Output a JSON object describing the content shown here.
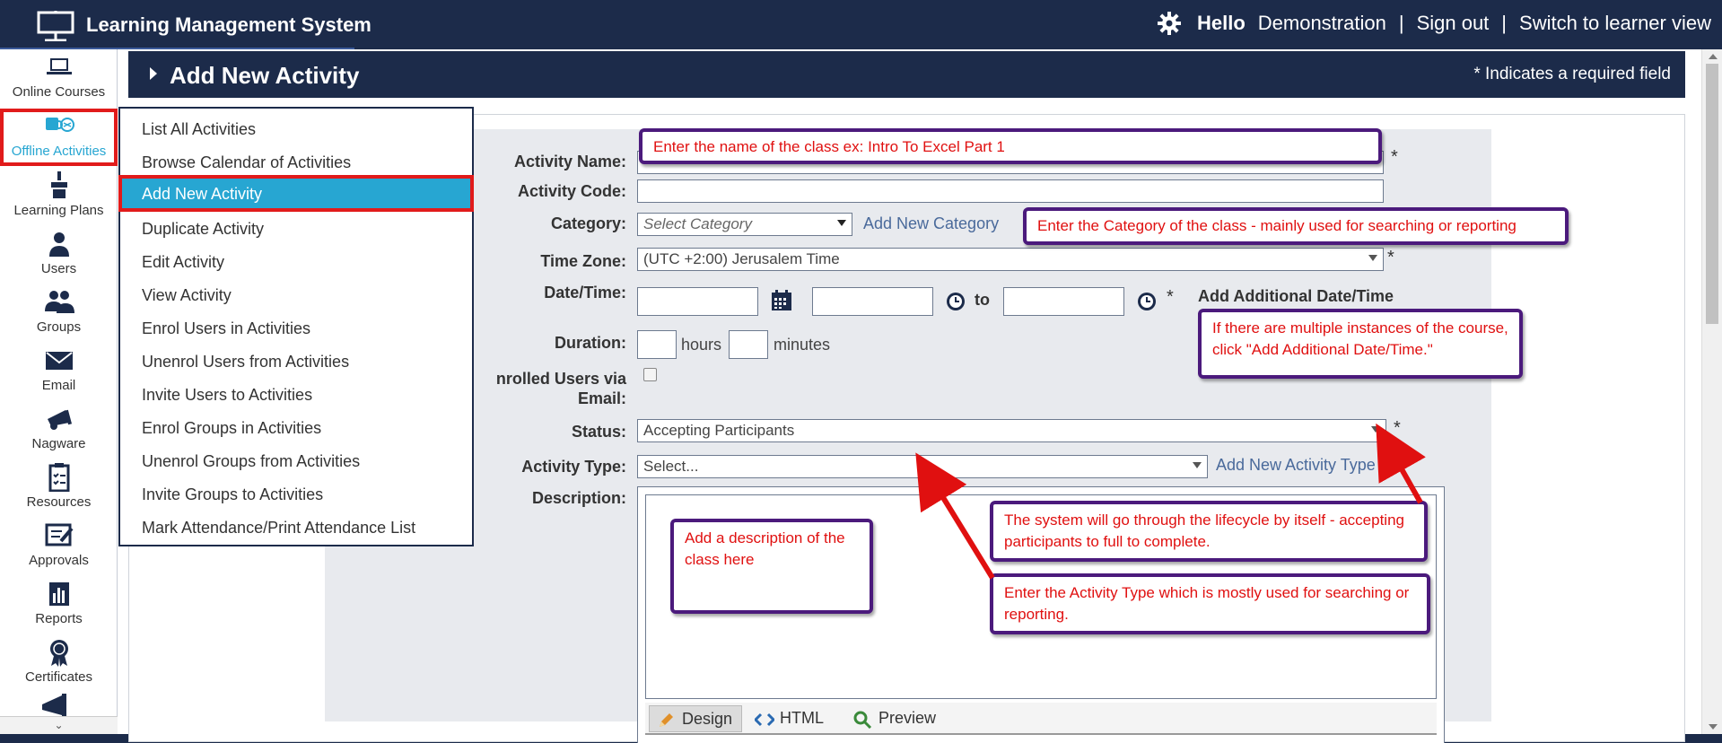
{
  "app": {
    "title": "Learning Management System"
  },
  "header": {
    "hello": "Hello",
    "user_name": "Demonstration",
    "separator": "|",
    "sign_out": "Sign out",
    "switch_view": "Switch to learner view"
  },
  "nav": {
    "items": [
      {
        "label": "Online Courses",
        "icon": "laptop-icon"
      },
      {
        "label": "Offline Activities",
        "icon": "offline-activities-icon",
        "active": true
      },
      {
        "label": "Learning Plans",
        "icon": "learning-plans-icon"
      },
      {
        "label": "Users",
        "icon": "user-icon"
      },
      {
        "label": "Groups",
        "icon": "groups-icon"
      },
      {
        "label": "Email",
        "icon": "envelope-icon"
      },
      {
        "label": "Nagware",
        "icon": "megaphone-icon"
      },
      {
        "label": "Resources",
        "icon": "clipboard-icon"
      },
      {
        "label": "Approvals",
        "icon": "approvals-icon"
      },
      {
        "label": "Reports",
        "icon": "bar-chart-icon"
      },
      {
        "label": "Certificates",
        "icon": "ribbon-icon"
      }
    ],
    "scroll_symbol": "⌄"
  },
  "page": {
    "title": "Add New Activity",
    "required_note": "* Indicates a required field"
  },
  "menu": {
    "items": [
      "List All Activities",
      "Browse Calendar of Activities",
      "Add New Activity",
      "Duplicate Activity",
      "Edit Activity",
      "View Activity",
      "Enrol Users in Activities",
      "Unenrol Users from Activities",
      "Invite Users to Activities",
      "Enrol Groups in Activities",
      "Unenrol Groups from Activities",
      "Invite Groups to Activities",
      "Mark Attendance/Print Attendance List"
    ],
    "active_index": 2
  },
  "form": {
    "activity_name_label": "Activity Name:",
    "activity_code_label": "Activity Code:",
    "category_label": "Category:",
    "category_placeholder": "Select Category",
    "add_new_category": "Add New Category",
    "timezone_label": "Time Zone:",
    "timezone_value": "(UTC +2:00) Jerusalem Time",
    "datetime_label": "Date/Time:",
    "to_label": "to",
    "add_additional_datetime": "Add Additional Date/Time",
    "duration_label": "Duration:",
    "hours_label": "hours",
    "minutes_label": "minutes",
    "enrolled_email_label_1": "nrolled Users via",
    "enrolled_email_label_2": "Email:",
    "status_label": "Status:",
    "status_value": "Accepting Participants",
    "activity_type_label": "Activity Type:",
    "activity_type_value": "Select...",
    "add_new_activity_type": "Add New Activity Type",
    "description_label": "Description:",
    "required_star": "*",
    "editor_tabs": [
      "Design",
      "HTML",
      "Preview"
    ]
  },
  "notes": {
    "name": "Enter the name of the class ex: Intro To Excel Part 1",
    "category": "Enter the Category of the class - mainly used for searching or reporting",
    "datetime": "If there are multiple instances of the course, click \"Add Additional Date/Time.\"",
    "description": "Add a description of the class here",
    "status": "The system will go through the lifecycle by itself - accepting participants to full to complete.",
    "activity_type": "Enter the Activity Type which is mostly used for searching or reporting."
  },
  "colors": {
    "navy": "#1c2b4a",
    "accent_blue": "#27a6d2",
    "highlight_red": "#e11b1b",
    "note_border": "#4b1a7c",
    "note_text": "#e01010"
  }
}
